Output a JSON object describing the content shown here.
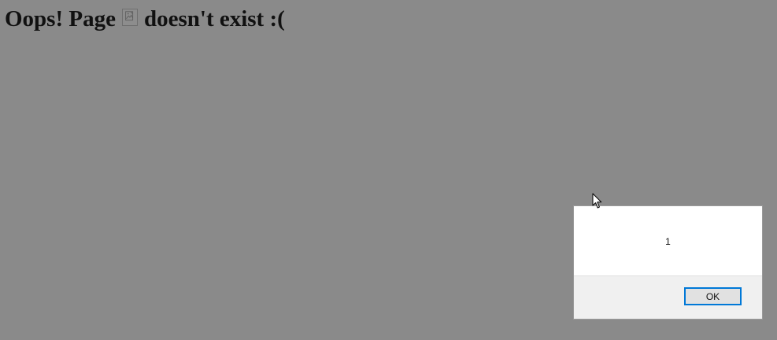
{
  "page": {
    "heading_prefix": "Oops! Page",
    "heading_suffix": "doesn't exist :(",
    "broken_image_icon": "broken-image-icon",
    "background_color": "#8a8a8a"
  },
  "alert_dialog": {
    "message": "1",
    "ok_label": "OK",
    "accent_color": "#0078d7"
  },
  "cursor": {
    "icon": "mouse-pointer-icon"
  }
}
